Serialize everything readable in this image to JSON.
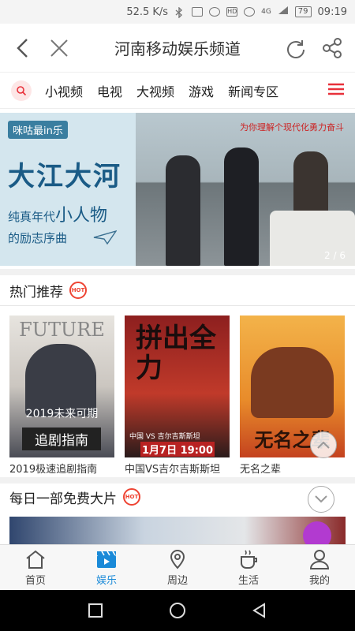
{
  "status": {
    "speed": "52.5 K/s",
    "signal": "4G",
    "battery": "79",
    "time": "09:19"
  },
  "header": {
    "title": "河南移动娱乐频道",
    "back_icon": "back-arrow-icon",
    "close_icon": "close-icon",
    "refresh_icon": "refresh-icon",
    "share_icon": "share-icon"
  },
  "categories": {
    "tabs": [
      "小视频",
      "电视",
      "大视频",
      "游戏",
      "新闻专区"
    ],
    "accent": "#e8303a"
  },
  "banner": {
    "brand": "咪咕最in乐",
    "headline": "大江大河",
    "subtitle_prefix": "纯真年代",
    "subtitle_highlight": "小人物",
    "subtitle_line2": "的励志序曲",
    "tag": "为你理解个现代化勇力奋斗",
    "pager": "2 / 6"
  },
  "hot": {
    "title": "热门推荐",
    "badge": "HOT",
    "items": [
      {
        "caption": "2019极速追剧指南",
        "poster_title": "FUTURE",
        "poster_line1": "2019未来可期",
        "poster_line2": "追剧指南"
      },
      {
        "caption": "中国VS吉尔吉斯斯坦",
        "poster_title": "拼出全力",
        "poster_line1": "中国 VS 吉尔吉斯斯坦",
        "poster_line2": "1月7日 19:00"
      },
      {
        "caption": "无名之辈",
        "poster_title": "无名之辈"
      }
    ]
  },
  "daily": {
    "title": "每日一部免费大片",
    "badge": "HOT"
  },
  "bottom_nav": [
    {
      "label": "首页",
      "icon": "home-icon"
    },
    {
      "label": "娱乐",
      "icon": "video-clapper-icon"
    },
    {
      "label": "周边",
      "icon": "location-pin-icon"
    },
    {
      "label": "生活",
      "icon": "coffee-cup-icon"
    },
    {
      "label": "我的",
      "icon": "user-icon"
    }
  ],
  "colors": {
    "active_nav": "#1a8ad8",
    "hot_red": "#e43"
  }
}
